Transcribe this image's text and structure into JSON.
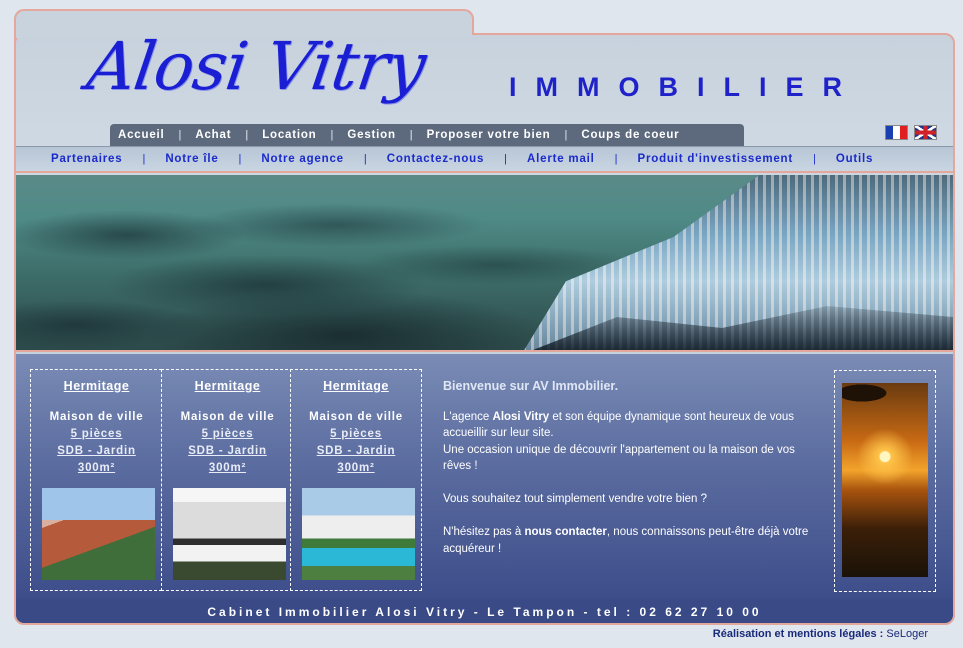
{
  "header": {
    "logo_text": "Alosi Vitry",
    "tagline": "IMMOBILIER"
  },
  "main_nav": [
    "Accueil",
    "Achat",
    "Location",
    "Gestion",
    "Proposer votre bien",
    "Coups de coeur"
  ],
  "sub_nav": [
    "Partenaires",
    "Notre île",
    "Notre agence",
    "Contactez-nous",
    "Alerte mail",
    "Produit d'investissement",
    "Outils"
  ],
  "languages": [
    "français",
    "english"
  ],
  "listings": [
    {
      "location": "Hermitage",
      "type": "Maison de ville",
      "rooms": "5 pièces",
      "features": "SDB - Jardin",
      "area": "300m²"
    },
    {
      "location": "Hermitage",
      "type": "Maison de ville",
      "rooms": "5 pièces",
      "features": "SDB - Jardin",
      "area": "300m²"
    },
    {
      "location": "Hermitage",
      "type": "Maison de ville",
      "rooms": "5 pièces",
      "features": "SDB - Jardin",
      "area": "300m²"
    }
  ],
  "welcome": {
    "title": "Bienvenue sur AV Immobilier.",
    "p1_before": "L'agence ",
    "p1_bold": "Alosi Vitry",
    "p1_after": " et son équipe dynamique sont heureux de vous accueillir sur leur site.",
    "p1_line2": "Une occasion unique de découvrir l'appartement ou la maison de vos rêves !",
    "p2": "Vous souhaitez tout simplement vendre votre bien ?",
    "p3_before": "N'hésitez pas à ",
    "p3_link": "nous contacter",
    "p3_after": ", nous connaissons peut-être déjà votre acquéreur !"
  },
  "footer": {
    "text": "Cabinet Immobilier Alosi Vitry - Le Tampon - tel : 02 62 27 10 00"
  },
  "credits": {
    "label": "Réalisation et mentions légales :",
    "link": "SeLoger"
  },
  "colors": {
    "brand_blue": "#1b1fd4",
    "accent_border": "#e3a79c",
    "footer_bar": "#3a4a86"
  }
}
